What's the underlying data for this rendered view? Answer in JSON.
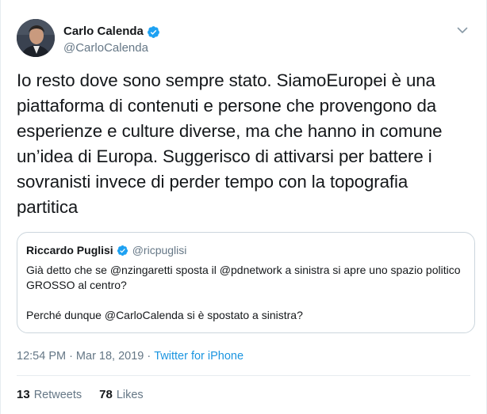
{
  "author": {
    "display_name": "Carlo Calenda",
    "handle": "@CarloCalenda",
    "verified": true,
    "avatar_icon": "profile-photo"
  },
  "tweet": {
    "text": "Io resto dove sono sempre stato. SiamoEuropei è una\npiattaforma di contenuti e persone che provengono da\nesperienze e culture diverse, ma che hanno in comune\nun’idea di Europa. Suggerisco di attivarsi per battere i\nsovranisti invece di perder tempo con la topografia\npartitica"
  },
  "quoted_tweet": {
    "display_name": "Riccardo Puglisi",
    "handle": "@ricpuglisi",
    "verified": true,
    "paragraph_1": "Già detto che se @nzingaretti sposta il @pdnetwork a sinistra si apre uno spazio politico GROSSO al centro?",
    "paragraph_2": "Perché dunque @CarloCalenda si è spostato a sinistra?"
  },
  "meta": {
    "time": "12:54 PM",
    "separator": "·",
    "date": "Mar 18, 2019",
    "source": "Twitter for iPhone"
  },
  "stats": {
    "retweets_count": "13",
    "retweets_label": "Retweets",
    "likes_count": "78",
    "likes_label": "Likes"
  },
  "colors": {
    "verified_blue": "#1da1f2",
    "link_blue": "#1b95e0",
    "secondary_text": "#657786",
    "border": "#ccd6dd"
  }
}
